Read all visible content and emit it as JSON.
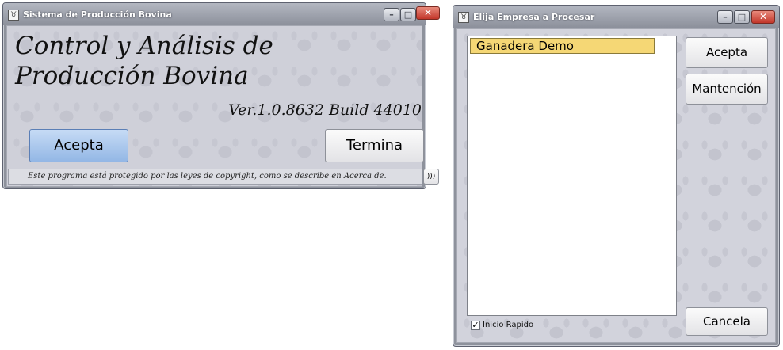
{
  "window1": {
    "title": "Sistema de Producción Bovina",
    "heading": "Control y Análisis de Producción Bovina",
    "version": "Ver.1.0.8632 Build 44010",
    "accept_label": "Acepta",
    "exit_label": "Termina",
    "status_text": "Este programa está protegido por las leyes de copyright, como se describe en Acerca de.",
    "status_button_label": ")))"
  },
  "window2": {
    "title": "Elija Empresa a Procesar",
    "list_items": [
      "Ganadera Demo"
    ],
    "accept_label": "Acepta",
    "maintenance_label": "Mantención",
    "cancel_label": "Cancela",
    "quick_start_label": "Inicio Rapido",
    "quick_start_checked": true
  },
  "titlebar_buttons": {
    "minimize": "–",
    "maximize": "□",
    "close": "✕"
  },
  "icons": [
    "bull-icon",
    "minimize-icon",
    "maximize-icon",
    "close-icon",
    "check-icon"
  ],
  "colors": {
    "title_bar": "#9a9ea8",
    "primary_button": "#a9c6ee",
    "selected_item": "#f5d775",
    "client_bg": "#cfd0d9"
  }
}
